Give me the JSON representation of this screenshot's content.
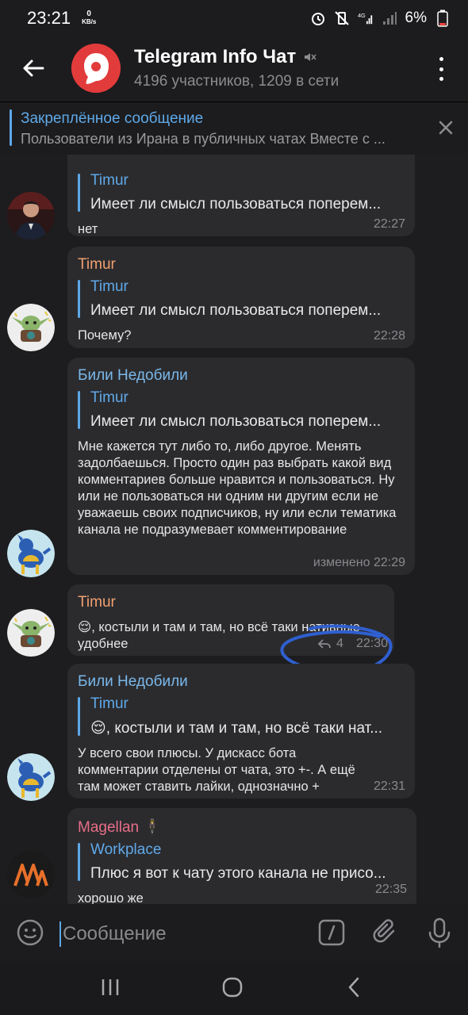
{
  "status_bar": {
    "time": "23:21",
    "net_speed": "0",
    "net_unit": "KB/s",
    "battery": "6%"
  },
  "header": {
    "title": "Telegram Info Чат",
    "subtitle": "4196 участников, 1209 в сети"
  },
  "pinned": {
    "title": "Закреплённое сообщение",
    "text": "Пользователи из Ирана в публичных чатах  Вместе с ..."
  },
  "messages": [
    {
      "author": "",
      "quote_name": "Timur",
      "quote_text": "Имеет ли смысл пользоваться поперем...",
      "text": "нет",
      "time": "22:27"
    },
    {
      "author": "Timur",
      "quote_name": "Timur",
      "quote_text": "Имеет ли смысл пользоваться поперем...",
      "text": "Почему?",
      "time": "22:28"
    },
    {
      "author": "Били Недобили",
      "quote_name": "Timur",
      "quote_text": "Имеет ли смысл пользоваться поперем...",
      "text": "Мне кажется тут либо то, либо другое. Менять задолбаешься. Просто один раз выбрать какой вид комментариев больше нравится и пользоваться. Ну или не пользоваться ни одним ни другим если не уважаешь своих подписчиков, ну или если тематика канала не подразумевает комментирование",
      "time": "изменено 22:29"
    },
    {
      "author": "Timur",
      "text": "😌, костыли и там и там, но всё таки нативные удобнее",
      "replies": "4",
      "time": "22:30"
    },
    {
      "author": "Били Недобили",
      "quote_name": "Timur",
      "quote_text": "😌, костыли и там и там, но всё таки нат...",
      "text": "У всего свои плюсы. У дискасс бота комментарии отделены от чата, это +-. А ещё там может ставить лайки, однозначно +",
      "time": "22:31"
    },
    {
      "author": "Magellan 🕴",
      "quote_name": "Workplace",
      "quote_text": "Плюс я вот к чату этого канала не присо...",
      "text": "хорошо же",
      "time": "22:35"
    }
  ],
  "input": {
    "placeholder": "Сообщение"
  },
  "colors": {
    "background": "#1d1d1f",
    "bubble": "#2b2b2e",
    "accent": "#5ea8e8",
    "author_timur": "#f0a070",
    "author_bili": "#7ab8ea",
    "author_magellan": "#e86e88",
    "annotation_circle": "#2f5fd0"
  }
}
